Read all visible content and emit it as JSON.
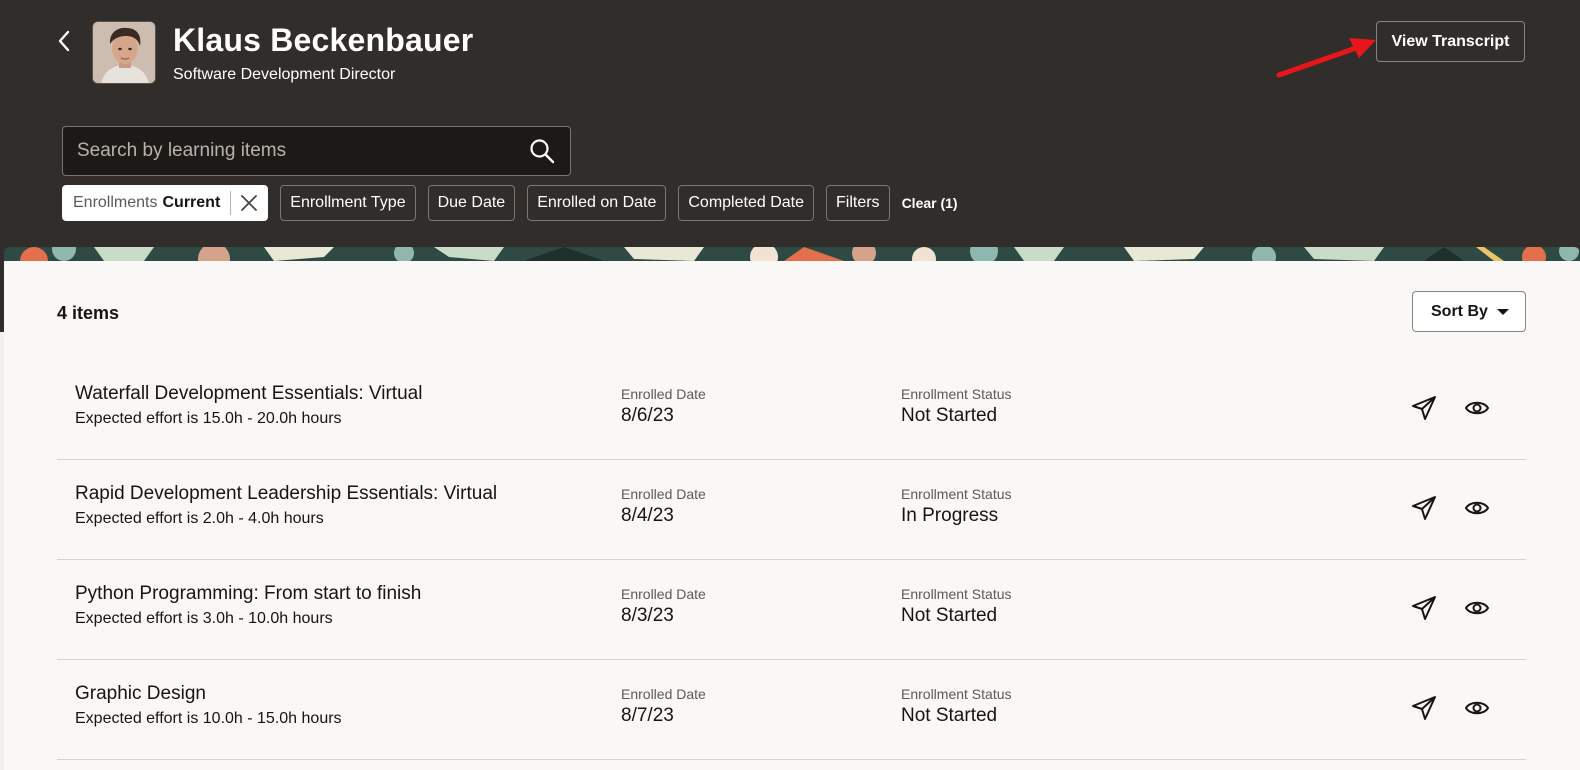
{
  "header": {
    "back_icon": "chevron-left-icon",
    "person": {
      "name": "Klaus Beckenbauer",
      "title": "Software Development Director"
    },
    "view_transcript_label": "View Transcript",
    "annotation_color": "#e8161b"
  },
  "search": {
    "placeholder": "Search by learning items",
    "value": "",
    "icon": "search-icon"
  },
  "filters": {
    "enrollments": {
      "label": "Enrollments",
      "value": "Current",
      "close_icon": "close-icon"
    },
    "chips": [
      "Enrollment Type",
      "Due Date",
      "Enrolled on Date",
      "Completed Date",
      "Filters"
    ],
    "clear_label": "Clear (1)"
  },
  "results": {
    "count_label": "4 items",
    "sort_label": "Sort By",
    "items": [
      {
        "title": "Waterfall Development Essentials: Virtual",
        "effort": "Expected effort is 15.0h - 20.0h hours",
        "enrolled_label": "Enrolled Date",
        "enrolled_value": "8/6/23",
        "status_label": "Enrollment Status",
        "status_value": "Not Started"
      },
      {
        "title": "Rapid Development Leadership Essentials: Virtual",
        "effort": "Expected effort is 2.0h - 4.0h hours",
        "enrolled_label": "Enrolled Date",
        "enrolled_value": "8/4/23",
        "status_label": "Enrollment Status",
        "status_value": "In Progress"
      },
      {
        "title": "Python Programming: From start to finish",
        "effort": "Expected effort is 3.0h - 10.0h hours",
        "enrolled_label": "Enrolled Date",
        "enrolled_value": "8/3/23",
        "status_label": "Enrollment Status",
        "status_value": "Not Started"
      },
      {
        "title": "Graphic Design",
        "effort": "Expected effort is 10.0h - 15.0h hours",
        "enrolled_label": "Enrolled Date",
        "enrolled_value": "8/7/23",
        "status_label": "Enrollment Status",
        "status_value": "Not Started"
      }
    ],
    "row_icons": [
      "send-icon",
      "eye-icon"
    ]
  },
  "colors": {
    "header_bg": "#312d2a",
    "panel_bg": "#f9f8f6",
    "banner": [
      "#3a5a54",
      "#e3704a",
      "#c9dcc8",
      "#e9c46a",
      "#8fb7b0"
    ]
  }
}
